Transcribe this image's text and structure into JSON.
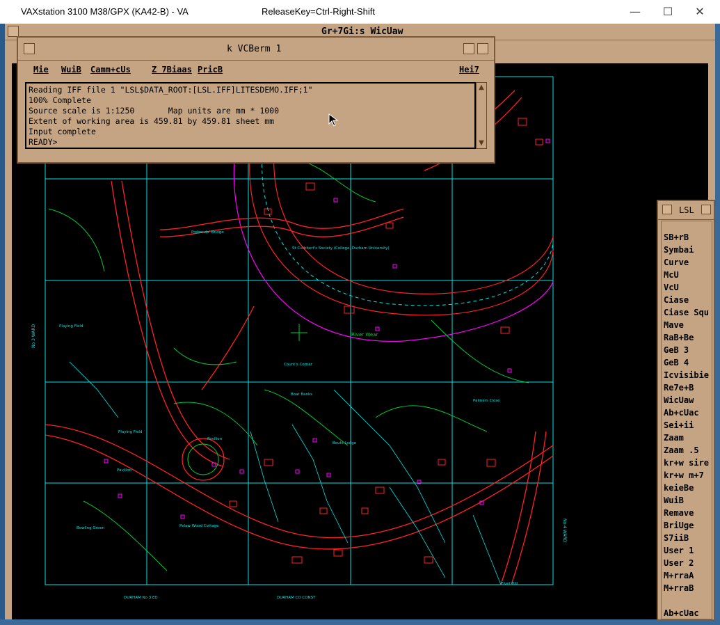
{
  "host": {
    "title": "VAXstation 3100 M38/GPX (KA42-B) - VA",
    "release_key": "ReleaseKey=Ctrl-Right-Shift",
    "minimize": "—",
    "maximize": "☐",
    "close": "✕"
  },
  "graphics_window": {
    "title": "Gr+7Gi:s WicUaw"
  },
  "terminal": {
    "title": "k VCBerm 1",
    "menu": [
      "Mie",
      "WuiB",
      "Camm+cUs",
      "Z 7Biaas",
      "PricB",
      "Hei7"
    ],
    "lines": [
      "Reading IFF file 1 \"LSL$DATA_ROOT:[LSL.IFF]LITESDEMO.IFF;1\"",
      "100% Complete",
      "Source scale is 1:1250       Map units are mm * 1000",
      "Extent of working area is 459.81 by 459.81 sheet mm",
      "Input complete",
      "READY>"
    ]
  },
  "lsl_menu": {
    "title": "LSL",
    "items": [
      "SB+rB",
      "Symbai",
      "Curve",
      "McU",
      "VcU",
      "Ciase",
      "Ciase Squ",
      "Mave",
      "RaB+Be",
      "GeB 3",
      "GeB 4",
      "Icvisibie",
      "Re7e+B",
      "WicUaw",
      "Ab+cUac",
      "Sei+ii",
      "Zaam",
      "Zaam .5",
      "kr+w sire",
      "kr+w m+7",
      "keieBe",
      "WuiB",
      "Remave",
      "BriUge",
      "S7iiB",
      "User 1",
      "User 2",
      "M+rraA",
      "M+rraB",
      "Ab+cUac"
    ]
  },
  "map": {
    "labels": [
      "Prebends' Bridge",
      "St Cuthbert's Society (College, Durham University)",
      "River Wear",
      "Count's Corner",
      "Playing Field",
      "DURHAM No 3 ED",
      "DURHAM CO CONST",
      "Boat Banks",
      "Pavilion",
      "Palmers Close",
      "Elvet Hill",
      "Bouts Lodge",
      "Playing Field",
      "Pavilion",
      "Pelaw Wood Cottage",
      "Bowling Green"
    ],
    "side_left": "No 3 WARD",
    "side_right": "No 4 WARD"
  },
  "colors": {
    "grid": "#00e5e5",
    "road": "#ff2222",
    "veg": "#00cc33",
    "building": "#ff00ff",
    "window": "#c4a482"
  }
}
